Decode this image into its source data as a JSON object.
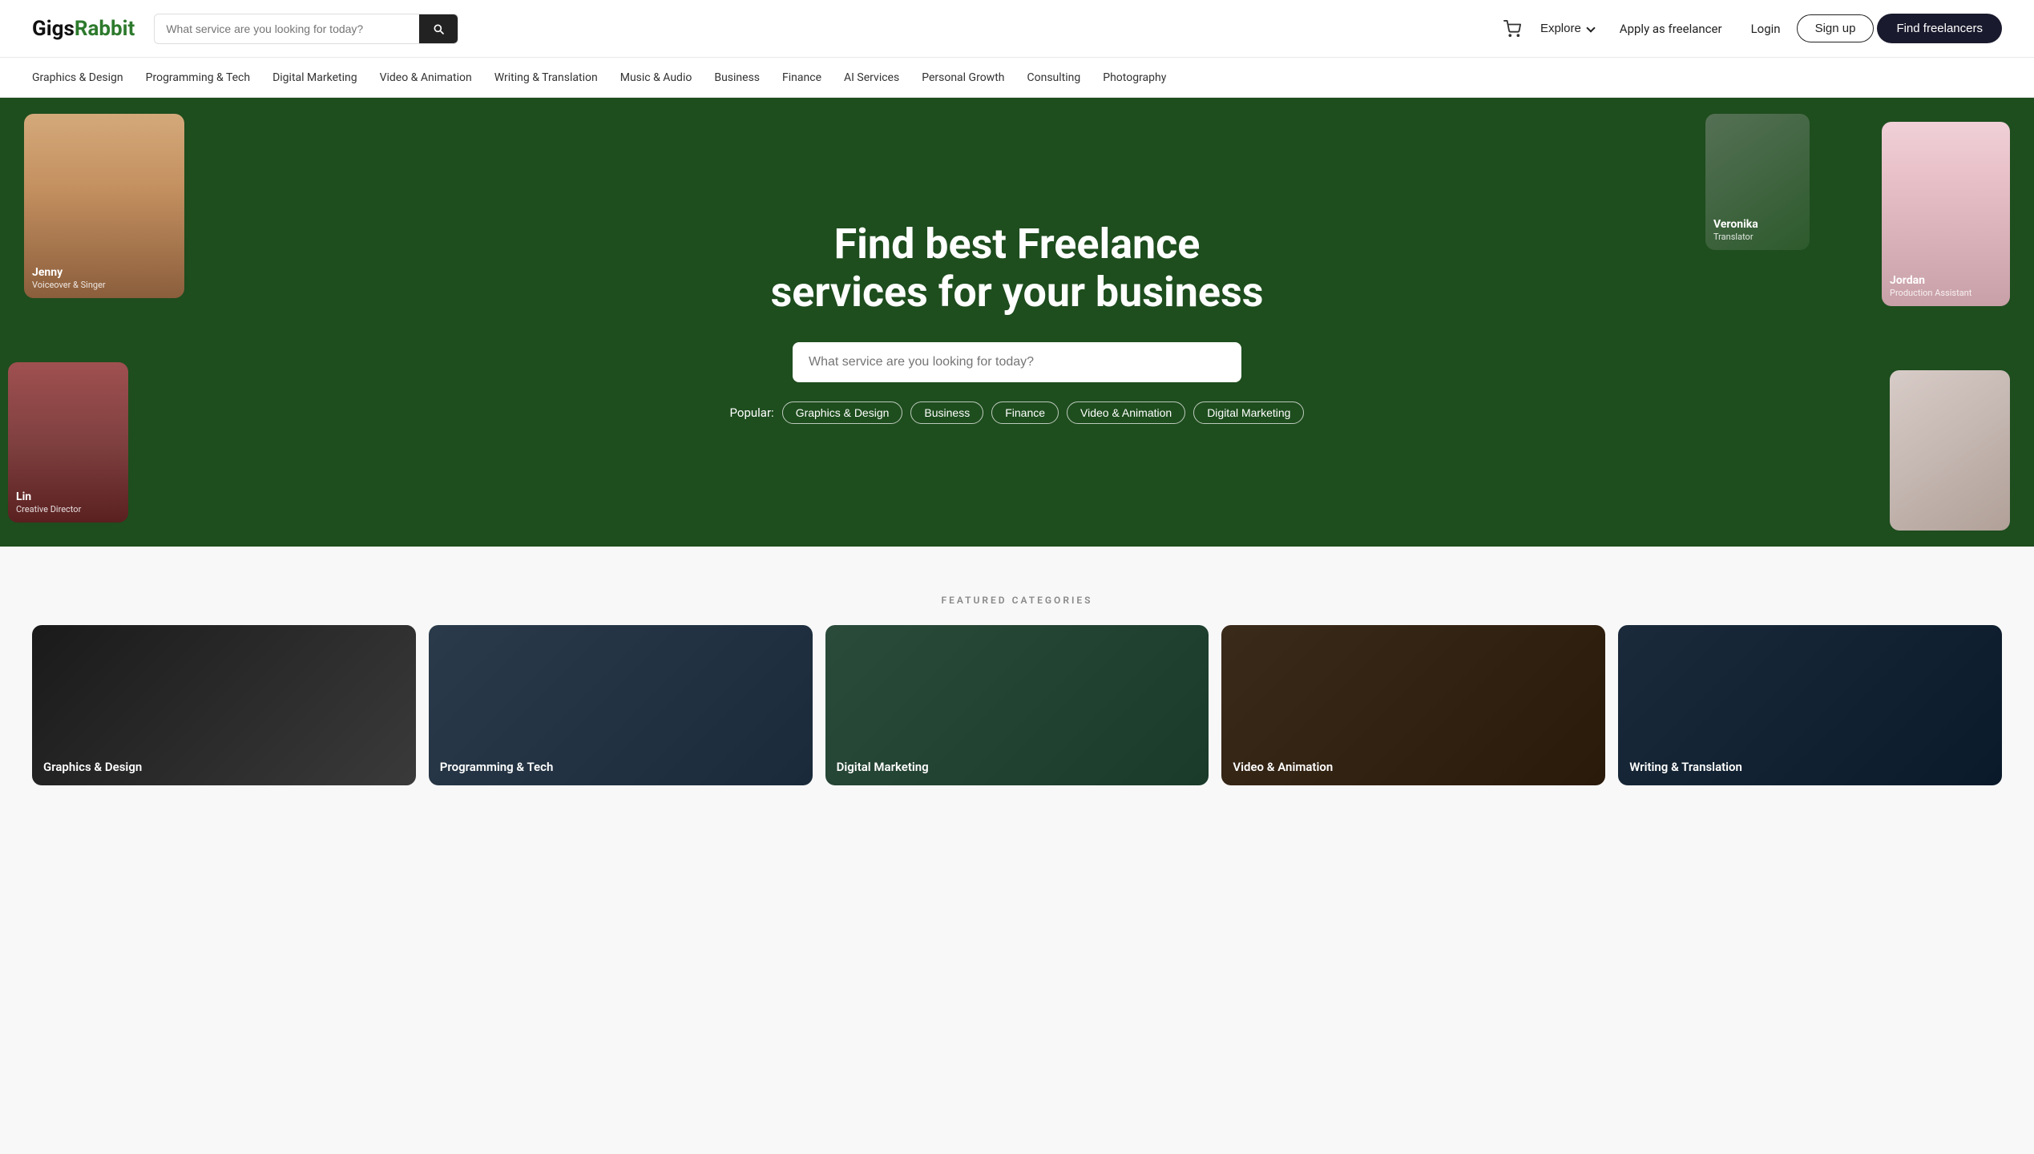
{
  "header": {
    "logo_gigs": "Gigs",
    "logo_rabbit": "Rabbit",
    "search_placeholder": "What service are you looking for today?",
    "explore_label": "Explore",
    "apply_label": "Apply as freelancer",
    "login_label": "Login",
    "signup_label": "Sign up",
    "find_label": "Find freelancers"
  },
  "category_nav": {
    "items": [
      "Graphics & Design",
      "Programming & Tech",
      "Digital Marketing",
      "Video & Animation",
      "Writing & Translation",
      "Music & Audio",
      "Business",
      "Finance",
      "AI Services",
      "Personal Growth",
      "Consulting",
      "Photography"
    ]
  },
  "hero": {
    "title_line1": "Find best Freelance",
    "title_line2": "services for your business",
    "search_placeholder": "What service are you looking for today?",
    "popular_label": "Popular:",
    "popular_tags": [
      "Graphics & Design",
      "Business",
      "Finance",
      "Video & Animation",
      "Digital Marketing"
    ],
    "freelancers": [
      {
        "name": "Jenny",
        "role": "Voiceover & Singer"
      },
      {
        "name": "Veronika",
        "role": "Translator"
      },
      {
        "name": "Jordan",
        "role": "Production Assistant"
      },
      {
        "name": "Lin",
        "role": "Creative Director"
      },
      {
        "name": "",
        "role": ""
      }
    ]
  },
  "featured_categories": {
    "section_label": "FEATURED CATEGORIES",
    "cards": [
      {
        "label": "Graphics & Design"
      },
      {
        "label": "Programming & Tech"
      },
      {
        "label": "Digital Marketing"
      },
      {
        "label": "Video & Animation"
      },
      {
        "label": "Writing & Translation"
      }
    ]
  }
}
